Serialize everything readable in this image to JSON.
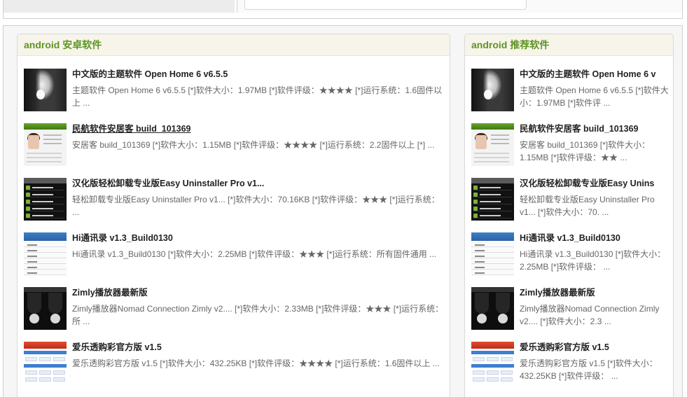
{
  "left_panel": {
    "title": "android 安卓软件",
    "items": [
      {
        "title": "中文版的主题软件 Open Home 6 v6.5.5",
        "desc": "主题软件 Open Home 6 v6.5.5 [*]软件大小：1.97MB [*]软件评级：★★★★ [*]运行系统：1.6固件以上 ...",
        "thumb": "photo"
      },
      {
        "title": "民航软件安居客 build_101369",
        "desc": "安居客 build_101369 [*]软件大小：1.15MB [*]软件评级：★★★★ [*]运行系统：2.2固件以上 [*] ...",
        "thumb": "anju"
      },
      {
        "title": "汉化版轻松卸载专业版Easy Uninstaller Pro v1...",
        "desc": "轻松卸载专业版Easy Uninstaller Pro v1... [*]软件大小：70.16KB [*]软件评级：★★★ [*]运行系统： ...",
        "thumb": "uninstaller"
      },
      {
        "title": "Hi通讯录 v1.3_Build0130",
        "desc": "Hi通讯录 v1.3_Build0130 [*]软件大小：2.25MB [*]软件评级：★★★ [*]运行系统：所有固件通用 ...",
        "thumb": "hi-contacts"
      },
      {
        "title": "Zimly播放器最新版",
        "desc": "Zimly播放器Nomad Connection Zimly v2.... [*]软件大小：2.33MB [*]软件评级：★★★ [*]运行系统：所 ...",
        "thumb": "zimly"
      },
      {
        "title": "爱乐透购彩官方版 v1.5",
        "desc": "爱乐透购彩官方版 v1.5 [*]软件大小：432.25KB [*]软件评级：★★★★ [*]运行系统：1.6固件以上 ...",
        "thumb": "lottery"
      }
    ]
  },
  "right_panel": {
    "title": "android 推荐软件",
    "items": [
      {
        "title": "中文版的主题软件 Open Home 6 v",
        "desc": "主题软件 Open Home 6 v6.5.5 [*]软件大小：1.97MB [*]软件评 ...",
        "thumb": "photo"
      },
      {
        "title": "民航软件安居客 build_101369",
        "desc": "安居客 build_101369 [*]软件大小：1.15MB [*]软件评级：★★ ...",
        "thumb": "anju"
      },
      {
        "title": "汉化版轻松卸载专业版Easy Unins",
        "desc": "轻松卸载专业版Easy Uninstaller Pro v1... [*]软件大小：70. ...",
        "thumb": "uninstaller"
      },
      {
        "title": "Hi通讯录 v1.3_Build0130",
        "desc": "Hi通讯录 v1.3_Build0130 [*]软件大小：2.25MB [*]软件评级： ...",
        "thumb": "hi-contacts"
      },
      {
        "title": "Zimly播放器最新版",
        "desc": "Zimly播放器Nomad Connection Zimly v2.... [*]软件大小：2.3 ...",
        "thumb": "zimly"
      },
      {
        "title": "爱乐透购彩官方版 v1.5",
        "desc": "爱乐透购彩官方版 v1.5 [*]软件大小：432.25KB [*]软件评级： ...",
        "thumb": "lottery"
      }
    ]
  },
  "colors": {
    "accent_green": "#5d9423",
    "title_text": "#222222",
    "desc_text": "#666666",
    "panel_header_bg": "#f7f5ea"
  }
}
